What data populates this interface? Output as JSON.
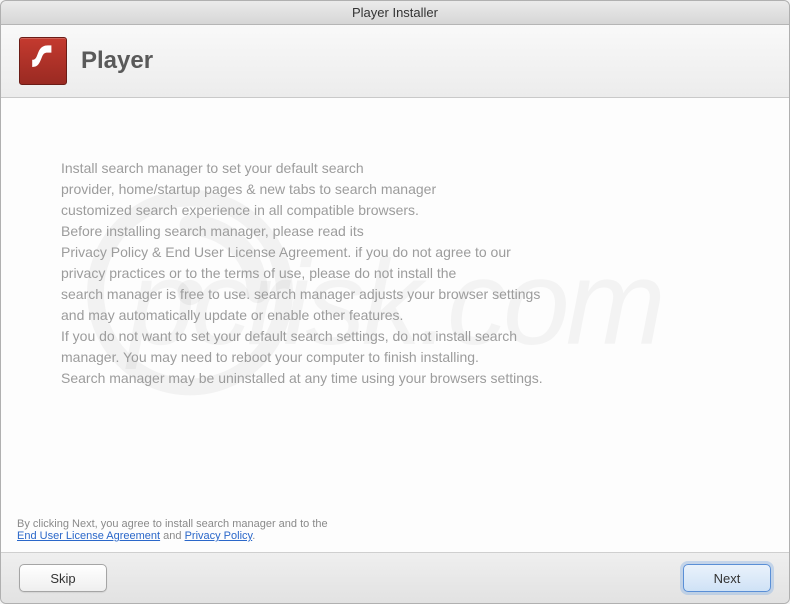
{
  "window": {
    "title": "Player Installer"
  },
  "header": {
    "title": "Player",
    "icon_name": "flash-player-icon"
  },
  "body": {
    "lines": [
      "Install search manager to set your default search",
      "provider, home/startup pages & new tabs to search manager",
      "customized search experience in all compatible browsers.",
      "Before installing search manager, please read its",
      "Privacy Policy & End User License Agreement. if you do not agree to our",
      "privacy practices or to the terms of use, please do not install the",
      "search manager is free to use. search manager adjusts your browser settings",
      "and may automatically update or enable other features.",
      "If you do not want to set your default search settings, do not install search",
      "manager. You may need to reboot your computer to finish installing.",
      "Search manager may be uninstalled at any time using your browsers settings."
    ]
  },
  "agreement": {
    "prefix": "By clicking Next, you agree to install search manager and to the",
    "eula_label": "End User License Agreement",
    "and_text": " and ",
    "privacy_label": "Privacy Policy",
    "suffix": "."
  },
  "footer": {
    "skip_label": "Skip",
    "next_label": "Next"
  },
  "watermark": {
    "text": "pcrisk.com"
  }
}
